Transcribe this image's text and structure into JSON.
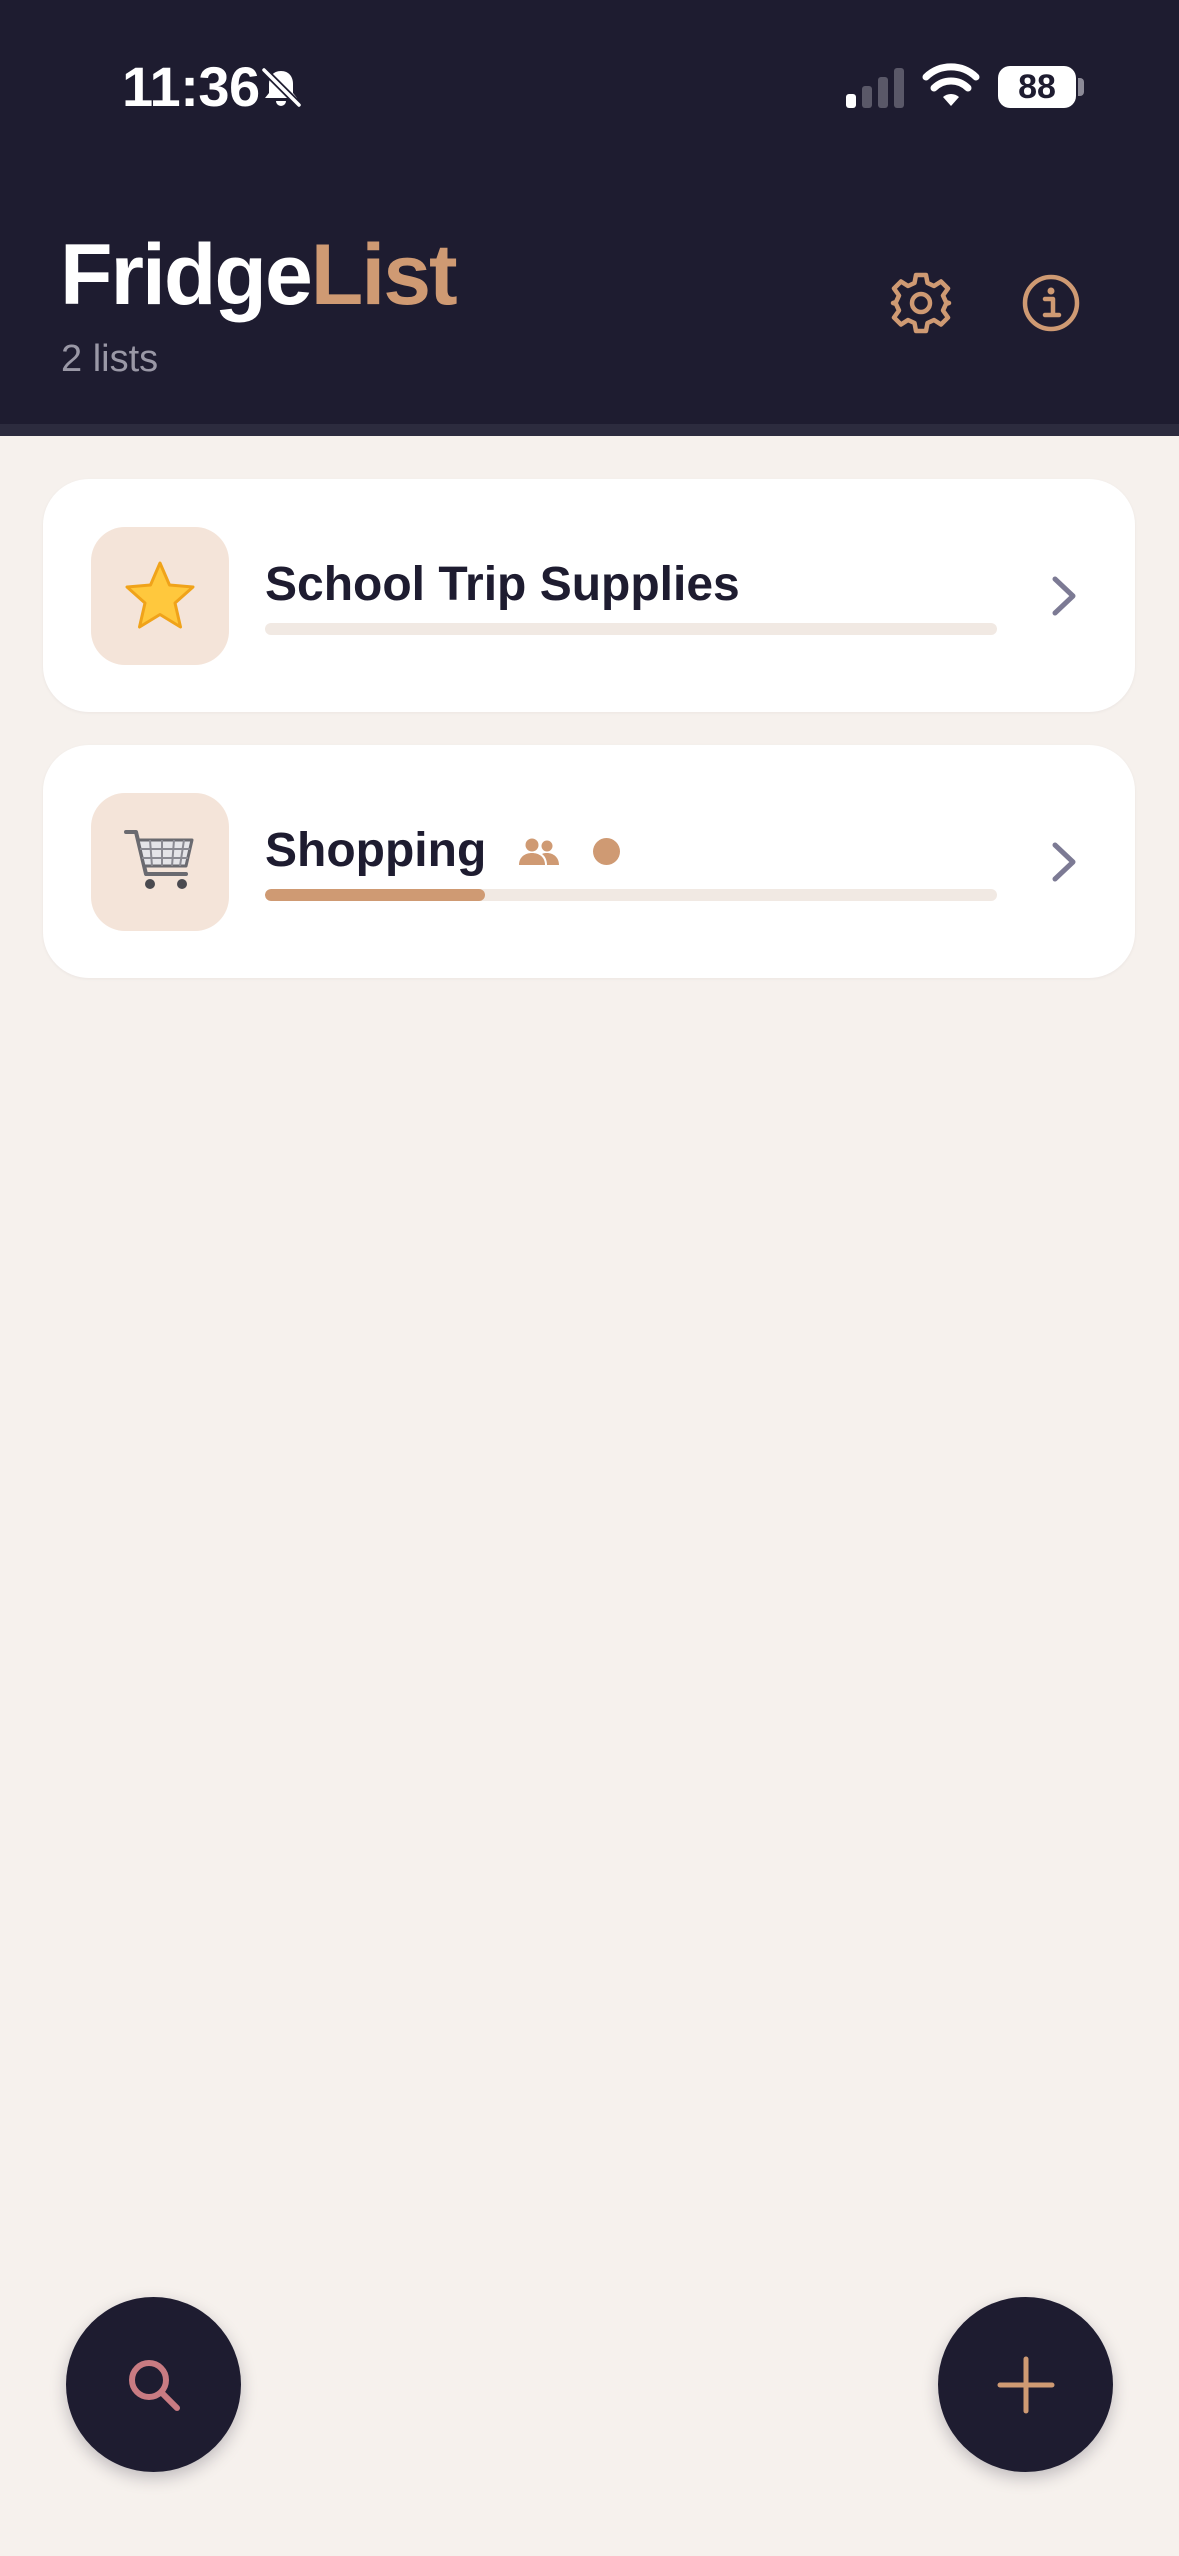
{
  "status_bar": {
    "time": "11:36",
    "battery": "88",
    "icons": [
      "bell-muted-icon",
      "cellular-signal-icon",
      "wifi-icon",
      "battery-icon"
    ]
  },
  "header": {
    "title_part1": "Fridge",
    "title_part2": "List",
    "subtitle": "2 lists",
    "actions": [
      "gear-icon",
      "info-icon"
    ]
  },
  "lists": [
    {
      "name": "School Trip Supplies",
      "icon": "star-icon",
      "progress": 0.0,
      "shared": false
    },
    {
      "name": "Shopping",
      "icon": "shopping-cart-icon",
      "progress": 0.3,
      "shared": true,
      "has_activity": true
    }
  ],
  "fabs": [
    "search-icon",
    "plus-icon"
  ],
  "colors": {
    "header_bg": "#1e1c30",
    "accent": "#cf9a73",
    "page_bg": "#f6f1ed",
    "card_bg": "#ffffff",
    "icon_tile_bg": "#f4e4d9",
    "search_icon": "#c97b82"
  }
}
